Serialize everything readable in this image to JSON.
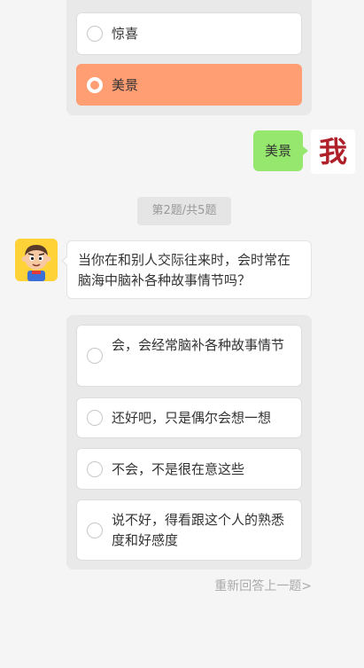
{
  "previous_question": {
    "options": [
      {
        "label": "惊喜",
        "selected": false
      },
      {
        "label": "美景",
        "selected": true
      }
    ]
  },
  "user_reply": {
    "text": "美景",
    "avatar_text": "我"
  },
  "progress": {
    "label": "第2题/共5题"
  },
  "bot_message": {
    "text": "当你在和别人交际往来时，会时常在脑海中脑补各种故事情节吗？"
  },
  "current_question": {
    "options": [
      {
        "label": "会，会经常脑补各种故事情节"
      },
      {
        "label": "还好吧，只是偶尔会想一想"
      },
      {
        "label": "不会，不是很在意这些"
      },
      {
        "label": "说不好，得看跟这个人的熟悉度和好感度"
      }
    ]
  },
  "redo": {
    "label": "重新回答上一题>"
  },
  "colors": {
    "selected_option": "#ff9d73",
    "user_bubble": "#95e76e",
    "bot_avatar_bg": "#ffd238",
    "avatar_text": "#b0202a"
  },
  "icons": {
    "bot_avatar": "cartoon-boy-avatar-icon",
    "radio": "radio-circle-icon"
  }
}
